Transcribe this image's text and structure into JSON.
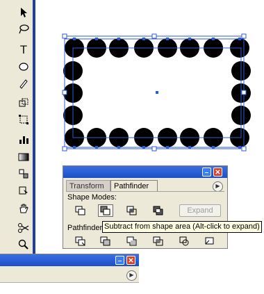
{
  "artwork": {
    "stroke_color": "#2d5bd6",
    "dot_color": "#000000"
  },
  "toolbar": {
    "tools": [
      {
        "name": "direct-selection-icon"
      },
      {
        "name": "lasso-icon"
      },
      {
        "name": "type-icon",
        "glyph": "T"
      },
      {
        "name": "ellipse-icon"
      },
      {
        "name": "pencil-icon"
      },
      {
        "name": "scale-icon"
      },
      {
        "name": "free-transform-icon"
      },
      {
        "name": "column-graph-icon"
      },
      {
        "name": "gradient-icon"
      },
      {
        "name": "blend-icon"
      },
      {
        "name": "live-paint-selection-icon"
      },
      {
        "name": "scissors-icon"
      },
      {
        "name": "zoom-icon"
      },
      {
        "name": "swap-fill-stroke-icon"
      }
    ]
  },
  "pathfinder_panel": {
    "tabs": [
      {
        "label": "Transform",
        "active": false
      },
      {
        "label": "Pathfinder",
        "active": true
      }
    ],
    "shape_modes_label": "Shape Modes:",
    "pathfinders_label": "Pathfinder",
    "expand_label": "Expand",
    "shape_mode_buttons": [
      "add-to-shape-area-icon",
      "subtract-from-shape-area-icon",
      "intersect-shape-areas-icon",
      "exclude-overlapping-shape-areas-icon"
    ],
    "pathfinder_buttons": [
      "divide-icon",
      "trim-icon",
      "merge-icon",
      "crop-icon",
      "outline-icon",
      "minus-back-icon"
    ],
    "minimize_glyph": "–",
    "close_glyph": "✕",
    "menu_glyph": "▶"
  },
  "tooltip": {
    "text": "Subtract from shape area (Alt-click to expand)"
  },
  "second_panel": {
    "minimize_glyph": "–",
    "close_glyph": "✕",
    "menu_glyph": "▶"
  }
}
